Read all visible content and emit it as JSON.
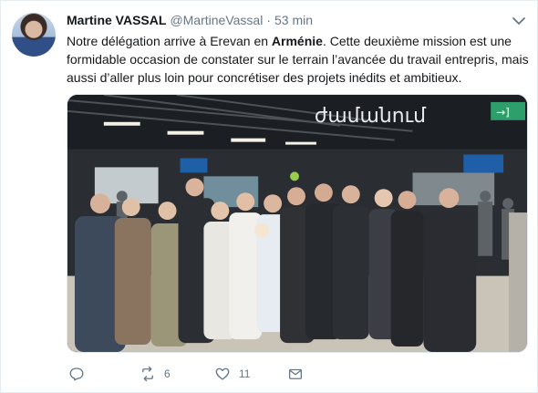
{
  "tweet": {
    "author_name": "Martine VASSAL",
    "handle": "@MartineVassal",
    "separator": "·",
    "time": "53 min",
    "text_part1": "Notre délégation arrive à Erevan en ",
    "text_bold": "Arménie",
    "text_part2": ". Cette deuxième mission est une formidable occasion de constater sur le terrain l’avancée du travail entrepris, mais aussi d’aller plus loin pour concrétiser des projets inédits et ambitieux.",
    "photo_sign_text": "ժամանում",
    "exit_sign_text": "→]"
  },
  "actions": {
    "reply_icon": "reply-icon",
    "retweet_icon": "retweet-icon",
    "retweet_count": "6",
    "like_icon": "heart-icon",
    "like_count": "11",
    "dm_icon": "envelope-icon"
  },
  "colors": {
    "text": "#14171a",
    "muted": "#657786",
    "border": "#e6ecf0"
  }
}
